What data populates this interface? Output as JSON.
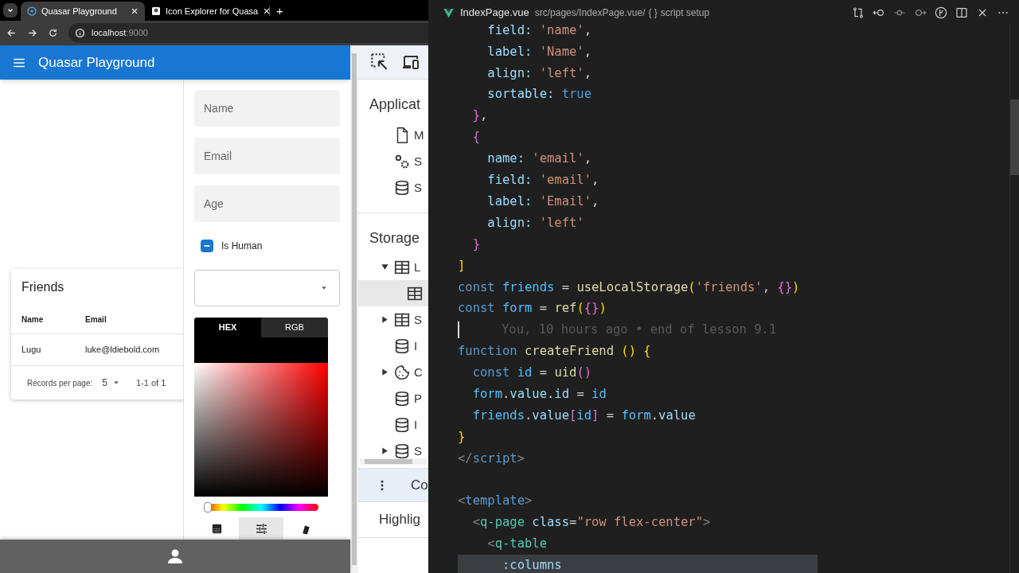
{
  "browser": {
    "tabs": [
      {
        "title": "Quasar Playground",
        "selected": true
      },
      {
        "title": "Icon Explorer for Quasa",
        "selected": false
      }
    ],
    "new_tab": "+",
    "url": {
      "host": "localhost",
      "port": ":9000"
    }
  },
  "app": {
    "title": "Quasar Playground",
    "friends_card": {
      "title": "Friends",
      "columns": [
        "Name",
        "Email"
      ],
      "rows": [
        [
          "Lugu",
          "luke@ldiebold.com"
        ]
      ],
      "pagination": {
        "label": "Records per page:",
        "per_page": "5",
        "range": "1-1 of 1"
      }
    },
    "form": {
      "fields": [
        {
          "placeholder": "Name"
        },
        {
          "placeholder": "Email"
        },
        {
          "placeholder": "Age"
        }
      ],
      "checkbox": {
        "label": "Is Human",
        "indeterminate": true
      },
      "color_picker": {
        "tabs": [
          {
            "label": "HEX",
            "selected": true
          },
          {
            "label": "RGB",
            "selected": false
          }
        ],
        "hue": {
          "level": 0
        },
        "bottom_tabs": [
          {
            "kind": "palette",
            "selected": false
          },
          {
            "kind": "tune",
            "selected": true
          },
          {
            "kind": "swatches",
            "selected": false
          }
        ]
      }
    }
  },
  "devtools": {
    "sections": [
      {
        "title": "Applicat",
        "items": [
          {
            "label": "M",
            "kind": "file",
            "selected": false
          },
          {
            "label": "S",
            "kind": "gears",
            "selected": false
          },
          {
            "label": "S",
            "kind": "database",
            "selected": false
          }
        ]
      },
      {
        "title": "Storage",
        "items": [
          {
            "label": "L",
            "kind": "table",
            "selected": false,
            "expanded": true,
            "children": [
              {
                "kind": "table",
                "selected": true
              }
            ]
          },
          {
            "label": "S",
            "kind": "table",
            "selected": false,
            "expanded": false
          },
          {
            "label": "I",
            "kind": "database",
            "selected": false
          },
          {
            "label": "C",
            "kind": "cookie",
            "selected": false,
            "expanded": false
          },
          {
            "label": "P",
            "kind": "database",
            "selected": false
          },
          {
            "label": "I",
            "kind": "database",
            "selected": false
          },
          {
            "label": "S",
            "kind": "database",
            "selected": false,
            "expanded": false
          }
        ]
      }
    ],
    "console_drawer": {
      "label": "Co"
    },
    "highlights": {
      "label": "Highlig"
    }
  },
  "editor": {
    "file": "IndexPage.vue",
    "path": "src/pages/IndexPage.vue/",
    "symbol": "{ }",
    "breadcrumb": "script setup",
    "lines": [
      {
        "kind": "code",
        "highlighted": false,
        "text": "    field: 'name',"
      },
      {
        "kind": "code",
        "highlighted": false,
        "text": "    label: 'Name',"
      },
      {
        "kind": "code",
        "highlighted": false,
        "text": "    align: 'left',"
      },
      {
        "kind": "code",
        "highlighted": false,
        "text": "    sortable: true"
      },
      {
        "kind": "code",
        "highlighted": false,
        "text": "  },"
      },
      {
        "kind": "code",
        "highlighted": false,
        "text": "  {"
      },
      {
        "kind": "code",
        "highlighted": false,
        "text": "    name: 'email',"
      },
      {
        "kind": "code",
        "highlighted": false,
        "text": "    field: 'email',"
      },
      {
        "kind": "code",
        "highlighted": false,
        "text": "    label: 'Email',"
      },
      {
        "kind": "code",
        "highlighted": false,
        "text": "    align: 'left'"
      },
      {
        "kind": "code",
        "highlighted": false,
        "text": "  }"
      },
      {
        "kind": "code",
        "highlighted": false,
        "text": "]"
      },
      {
        "kind": "code",
        "highlighted": false,
        "text": "const friends = useLocalStorage('friends', {})"
      },
      {
        "kind": "code",
        "highlighted": false,
        "text": "const form = ref({})"
      },
      {
        "kind": "blame",
        "highlighted": false,
        "text": "You, 10 hours ago • end of lesson 9.1"
      },
      {
        "kind": "code",
        "highlighted": false,
        "text": "function createFriend () {"
      },
      {
        "kind": "code",
        "highlighted": false,
        "text": "  const id = uid()"
      },
      {
        "kind": "code",
        "highlighted": false,
        "text": "  form.value.id = id"
      },
      {
        "kind": "code",
        "highlighted": false,
        "text": "  friends.value[id] = form.value"
      },
      {
        "kind": "code",
        "highlighted": false,
        "text": "}"
      },
      {
        "kind": "code",
        "highlighted": false,
        "text": "</script>"
      },
      {
        "kind": "empty",
        "highlighted": false
      },
      {
        "kind": "code",
        "highlighted": false,
        "text": "<template>"
      },
      {
        "kind": "code",
        "highlighted": false,
        "text": "  <q-page class=\"row flex-center\">"
      },
      {
        "kind": "code",
        "highlighted": false,
        "text": "    <q-table"
      },
      {
        "kind": "code",
        "highlighted": true,
        "text": "      :columns"
      }
    ]
  }
}
